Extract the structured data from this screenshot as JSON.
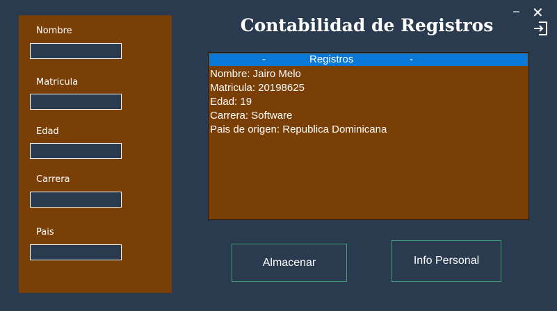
{
  "form": {
    "fields": [
      {
        "label": "Nombre",
        "value": ""
      },
      {
        "label": "Matricula",
        "value": ""
      },
      {
        "label": "Edad",
        "value": ""
      },
      {
        "label": "Carrera",
        "value": ""
      },
      {
        "label": "Pais",
        "value": ""
      }
    ]
  },
  "title": "Contabilidad de Registros",
  "window": {
    "minimize": "–",
    "close": "✕"
  },
  "list": {
    "header": {
      "left_dash": "-",
      "label": "Registros",
      "right_dash": "-"
    },
    "items": [
      "Nombre: Jairo Melo",
      "Matricula: 20198625",
      "Edad: 19",
      "Carrera: Software",
      "Pais de origen: Republica Dominicana"
    ]
  },
  "buttons": {
    "store": "Almacenar",
    "info": "Info Personal"
  },
  "colors": {
    "background": "#2a3b4f",
    "panel": "#7a3f06",
    "highlight": "#0a78d7",
    "button_border": "#3fa07a"
  }
}
